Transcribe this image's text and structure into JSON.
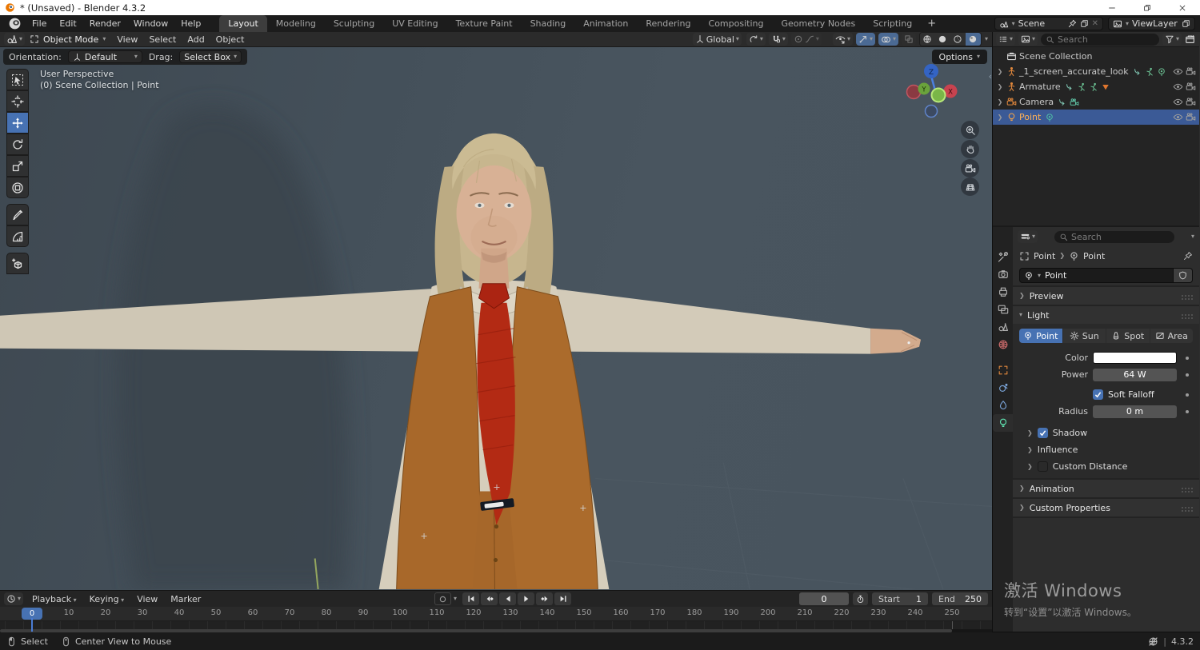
{
  "window": {
    "title": "* (Unsaved) - Blender 4.3.2",
    "controls": [
      {
        "icon": "win-min",
        "name": "minimize"
      },
      {
        "icon": "win-restore",
        "name": "restore"
      },
      {
        "icon": "win-close",
        "name": "close"
      }
    ]
  },
  "topbar": {
    "menus": [
      "File",
      "Edit",
      "Render",
      "Window",
      "Help"
    ],
    "workspaces": [
      "Layout",
      "Modeling",
      "Sculpting",
      "UV Editing",
      "Texture Paint",
      "Shading",
      "Animation",
      "Rendering",
      "Compositing",
      "Geometry Nodes",
      "Scripting"
    ],
    "active_workspace": "Layout",
    "add_workspace": "+",
    "scene_name": "Scene",
    "view_layer_name": "ViewLayer"
  },
  "viewport_header": {
    "mode": "Object Mode",
    "menus": [
      "View",
      "Select",
      "Add",
      "Object"
    ],
    "transform_orientation": "Global"
  },
  "tool_settings": {
    "orientation_label": "Orientation:",
    "orientation_value": "Default",
    "drag_label": "Drag:",
    "drag_value": "Select Box",
    "options_label": "Options"
  },
  "viewport": {
    "overlay_line1": "User Perspective",
    "overlay_line2": "(0) Scene Collection | Point",
    "axis_z": "Z",
    "axis_y": "Y",
    "axis_x": "X",
    "nav_icons": [
      "zoom-icon",
      "hand-icon",
      "camera-icon",
      "grid-icon"
    ],
    "collapse_glyph": "‹"
  },
  "toolbar": {
    "tools": [
      {
        "id": "select-box",
        "icon": "t-select"
      },
      {
        "id": "cursor",
        "icon": "t-cursor"
      },
      {
        "id": "move",
        "icon": "t-move",
        "active": true
      },
      {
        "id": "rotate",
        "icon": "t-rotate"
      },
      {
        "id": "scale",
        "icon": "t-scale"
      },
      {
        "id": "transform",
        "icon": "t-transform"
      },
      {
        "id": "annotate",
        "icon": "t-annotate",
        "gap": true
      },
      {
        "id": "measure",
        "icon": "t-measure"
      },
      {
        "id": "add-cube",
        "icon": "t-addcube",
        "gap": true
      }
    ]
  },
  "outliner": {
    "search_placeholder": "Search",
    "rows": [
      {
        "label": "Scene Collection",
        "icon": "collection",
        "icon_color": "#d9d9d9",
        "chevron": false,
        "badges": [],
        "eye": false,
        "cam": false
      },
      {
        "label": "_1_screen_accurate_look",
        "icon": "armature",
        "icon_color": "#e0873c",
        "chevron": true,
        "badges": [
          "link",
          "run",
          "pointlight-sm"
        ],
        "eye": true,
        "cam": true
      },
      {
        "label": "Armature",
        "icon": "armature",
        "icon_color": "#e0873c",
        "chevron": true,
        "badges": [
          "link",
          "run",
          "run",
          "tri"
        ],
        "eye": true,
        "cam": true
      },
      {
        "label": "Camera",
        "icon": "camera",
        "icon_color": "#e0873c",
        "chevron": true,
        "badges": [
          "link",
          "camera-g"
        ],
        "eye": true,
        "cam": true
      },
      {
        "label": "Point",
        "icon": "bulb",
        "icon_color": "#f0a14a",
        "chevron": true,
        "selected": true,
        "label_color": "#ffb054",
        "badges": [
          "pointlight"
        ],
        "eye": true,
        "cam": true
      }
    ]
  },
  "properties": {
    "search_placeholder": "Search",
    "tabs": [
      {
        "icon": "p-tool",
        "id": "tool"
      },
      {
        "icon": "p-render",
        "id": "render"
      },
      {
        "icon": "p-output",
        "id": "output"
      },
      {
        "icon": "p-viewlayer",
        "id": "view-layer"
      },
      {
        "icon": "p-scene",
        "id": "scene"
      },
      {
        "icon": "p-world",
        "id": "world",
        "color": "#c96a6a"
      },
      {
        "icon": "p-object",
        "id": "object",
        "color": "#e0873c",
        "gap": true
      },
      {
        "icon": "p-physics",
        "id": "physics",
        "color": "#7aa4d8"
      },
      {
        "icon": "p-constraint",
        "id": "constraints",
        "color": "#7aa4d8"
      },
      {
        "icon": "p-bulb",
        "id": "object-data",
        "color": "#5fe3b1",
        "active": true
      }
    ],
    "breadcrumb_1": "Point",
    "breadcrumb_2": "Point",
    "datablock_name": "Point",
    "panels": {
      "preview": "Preview",
      "light": "Light",
      "animation": "Animation",
      "custom_properties": "Custom Properties"
    },
    "light": {
      "types": [
        {
          "label": "Point",
          "icon": "lt-point",
          "active": true
        },
        {
          "label": "Sun",
          "icon": "lt-sun"
        },
        {
          "label": "Spot",
          "icon": "lt-spot"
        },
        {
          "label": "Area",
          "icon": "lt-area"
        }
      ],
      "color_label": "Color",
      "power_label": "Power",
      "power_value": "64 W",
      "soft_falloff_label": "Soft Falloff",
      "soft_falloff_checked": true,
      "radius_label": "Radius",
      "radius_value": "0 m",
      "shadow_label": "Shadow",
      "shadow_checked": true,
      "influence_label": "Influence",
      "custom_distance_label": "Custom Distance",
      "custom_distance_checked": false
    }
  },
  "timeline": {
    "menus_dropdown": [
      "Playback",
      "Keying"
    ],
    "menus_plain": [
      "View",
      "Marker"
    ],
    "playback_buttons": [
      "jump-start",
      "prev-keyframe",
      "play-reverse",
      "play",
      "next-keyframe",
      "jump-end"
    ],
    "current_frame": "0",
    "start_label": "Start",
    "start_value": "1",
    "end_label": "End",
    "end_value": "250",
    "ticks": [
      0,
      10,
      20,
      30,
      40,
      50,
      60,
      70,
      80,
      90,
      100,
      110,
      120,
      130,
      140,
      150,
      160,
      170,
      180,
      190,
      200,
      210,
      220,
      230,
      240,
      250
    ]
  },
  "watermark": {
    "line1": "激活 Windows",
    "line2": "转到“设置”以激活 Windows。"
  },
  "statusbar": {
    "left": [
      {
        "icon": "mouse-left",
        "label": "Select"
      },
      {
        "icon": "mouse-middle",
        "label": "Center View to Mouse"
      }
    ],
    "version_divider": "|",
    "version": "4.3.2"
  },
  "colors": {
    "accent": "#4772b3",
    "selection_row": "#3b5a96",
    "object_orange": "#e0873c",
    "data_green": "#5fe3b1",
    "active_label_orange": "#ffb054",
    "tie_red": "#b32a14",
    "vest_brown": "#a8682a"
  }
}
